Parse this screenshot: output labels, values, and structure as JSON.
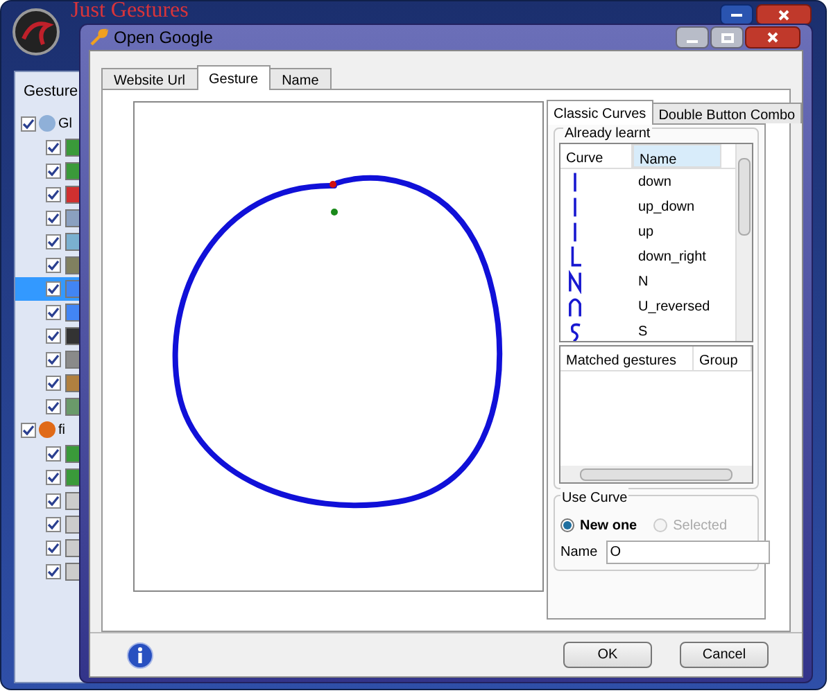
{
  "main_window": {
    "title": "Just Gestures",
    "panel_label": "Gesture",
    "tree": [
      {
        "label": "Gl",
        "checked": true,
        "children": [
          {
            "checked": true,
            "selected": false
          },
          {
            "checked": true,
            "selected": false
          },
          {
            "checked": true,
            "selected": false
          },
          {
            "checked": true,
            "selected": false
          },
          {
            "checked": true,
            "selected": false
          },
          {
            "checked": true,
            "selected": false
          },
          {
            "checked": true,
            "selected": true
          },
          {
            "checked": true,
            "selected": false
          },
          {
            "checked": true,
            "selected": false
          },
          {
            "checked": true,
            "selected": false
          },
          {
            "checked": true,
            "selected": false
          },
          {
            "checked": true,
            "selected": false
          }
        ]
      },
      {
        "label": "fi",
        "checked": true,
        "children": [
          {
            "checked": true,
            "selected": false
          },
          {
            "checked": true,
            "selected": false
          },
          {
            "checked": true,
            "selected": false
          },
          {
            "checked": true,
            "selected": false
          },
          {
            "checked": true,
            "selected": false
          },
          {
            "checked": true,
            "selected": false
          }
        ]
      }
    ]
  },
  "dialog": {
    "title": "Open Google",
    "tabs": [
      {
        "label": "Website Url",
        "selected": false
      },
      {
        "label": "Gesture",
        "selected": true
      },
      {
        "label": "Name",
        "selected": false
      }
    ],
    "curve_tabs": [
      {
        "label": "Classic Curves",
        "selected": true
      },
      {
        "label": "Double Button Combo",
        "selected": false
      }
    ],
    "learnt_group": {
      "title": "Already learnt",
      "columns": [
        "Curve",
        "Name"
      ],
      "rows": [
        {
          "name": "down"
        },
        {
          "name": "up_down"
        },
        {
          "name": "up"
        },
        {
          "name": "down_right"
        },
        {
          "name": "N"
        },
        {
          "name": "U_reversed"
        },
        {
          "name": "S"
        }
      ]
    },
    "matched": {
      "columns": [
        "Matched gestures",
        "Group"
      ]
    },
    "use_curve": {
      "title": "Use Curve",
      "options": [
        {
          "label": "New one",
          "selected": true,
          "disabled": false
        },
        {
          "label": "Selected",
          "selected": false,
          "disabled": true
        }
      ],
      "name_label": "Name",
      "name_value": "O"
    },
    "buttons": [
      "OK",
      "Cancel"
    ]
  }
}
